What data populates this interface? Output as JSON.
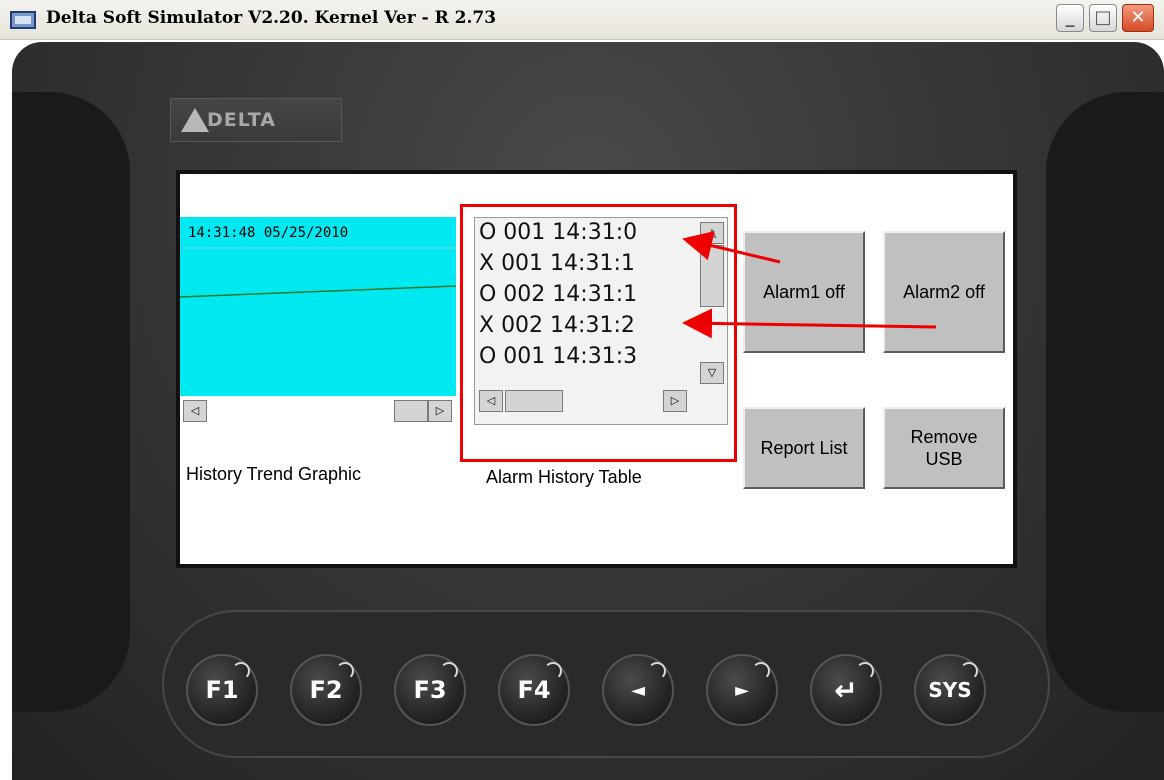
{
  "window": {
    "title": "Delta Soft Simulator V2.20. Kernel Ver - R 2.73",
    "min_glyph": "_",
    "max_glyph": "□",
    "close_glyph": "✕"
  },
  "device": {
    "logo_text": "DELTA"
  },
  "trend": {
    "timestamp": "14:31:48 05/25/2010",
    "caption": "History Trend Graphic",
    "scroll_left": "◁",
    "scroll_right": "▷"
  },
  "alarm_table": {
    "caption": "Alarm History Table",
    "rows": [
      "O 001 14:31:0",
      "X 001 14:31:1",
      "O 002 14:31:1",
      "X 002 14:31:2",
      "O 001 14:31:3"
    ],
    "scroll_up": "△",
    "scroll_down": "▽",
    "scroll_left": "◁",
    "scroll_right": "▷"
  },
  "buttons": {
    "alarm1_off": "Alarm1 off",
    "alarm2_off": "Alarm2 off",
    "report_list": "Report List",
    "remove_usb_line1": "Remove",
    "remove_usb_line2": "USB"
  },
  "keys": {
    "f1": "F1",
    "f2": "F2",
    "f3": "F3",
    "f4": "F4",
    "left": "◄",
    "right": "►",
    "enter": "↵",
    "sys": "SYS"
  },
  "colors": {
    "trend_bg": "#00e8f0",
    "annotation_red": "#ee0000",
    "led_yellow": "#d8e02a"
  }
}
